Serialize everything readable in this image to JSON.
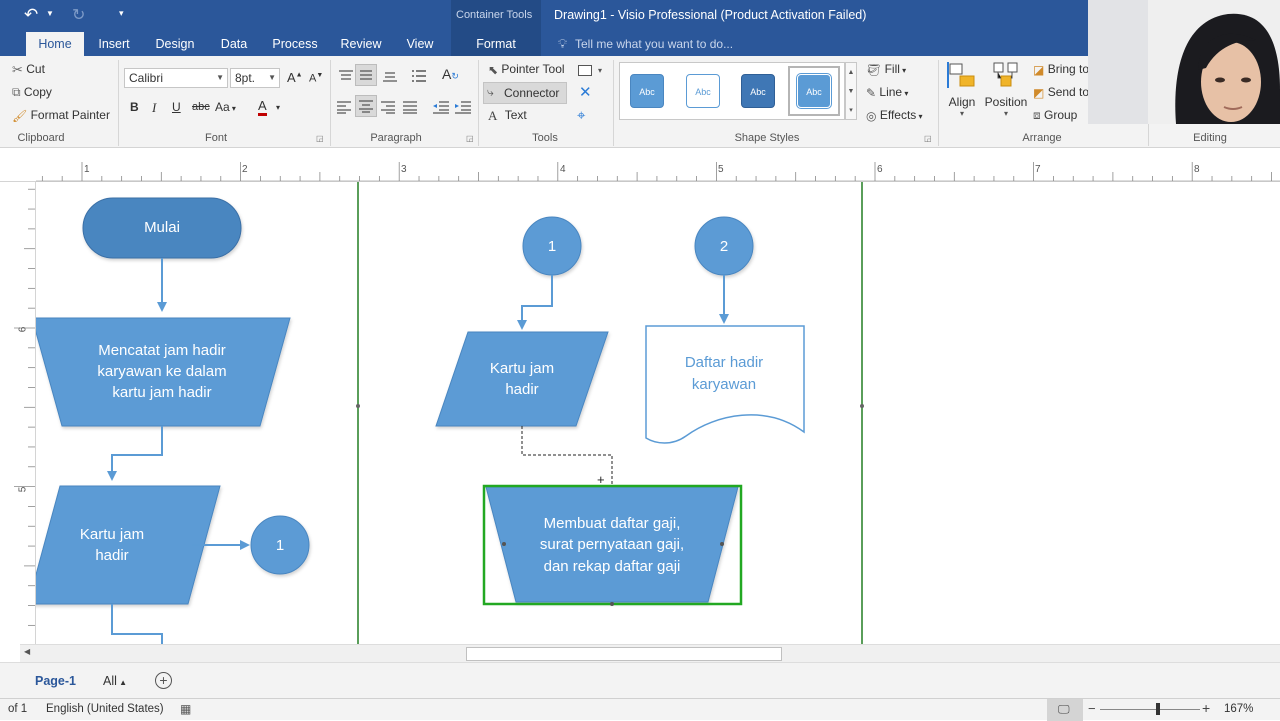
{
  "titlebar": {
    "context_tools": "Container Tools",
    "title": "Drawing1 - Visio Professional (Product Activation Failed)"
  },
  "tabs": {
    "home": "Home",
    "insert": "Insert",
    "design": "Design",
    "data": "Data",
    "process": "Process",
    "review": "Review",
    "view": "View",
    "format": "Format",
    "tell_me": "Tell me what you want to do..."
  },
  "ribbon": {
    "clipboard": {
      "cut": "Cut",
      "copy": "Copy",
      "format_painter": "Format Painter",
      "label": "Clipboard"
    },
    "font": {
      "family": "Calibri",
      "size": "8pt.",
      "label": "Font"
    },
    "paragraph": {
      "label": "Paragraph"
    },
    "tools": {
      "pointer": "Pointer Tool",
      "connector": "Connector",
      "text": "Text",
      "label": "Tools"
    },
    "shape_styles": {
      "abc": "Abc",
      "fill": "Fill",
      "line": "Line",
      "effects": "Effects",
      "label": "Shape Styles"
    },
    "arrange": {
      "align": "Align",
      "position": "Position",
      "bring": "Bring to",
      "send": "Send to",
      "group": "Group",
      "label": "Arrange"
    },
    "editing": {
      "label": "Editing"
    }
  },
  "ruler": {
    "h_ticks": [
      "1",
      "2",
      "3",
      "4",
      "5",
      "6",
      "7",
      "8"
    ],
    "v_ticks": [
      "6",
      "5"
    ]
  },
  "diagram": {
    "mulai": "Mulai",
    "mencatat": [
      "Mencatat jam hadir",
      "karyawan ke dalam",
      "kartu jam hadir"
    ],
    "kartu_left": [
      "Kartu jam",
      "hadir"
    ],
    "connector_1_left": "1",
    "connector_1": "1",
    "connector_2": "2",
    "kartu_mid": [
      "Kartu jam",
      "hadir"
    ],
    "daftar": [
      "Daftar hadir",
      "karyawan"
    ],
    "membuat": [
      "Membuat daftar gaji,",
      "surat pernyataan gaji,",
      "dan rekap daftar gaji"
    ]
  },
  "page_tabs": {
    "page1": "Page-1",
    "all": "All"
  },
  "status": {
    "page": "of 1",
    "language": "English (United States)",
    "zoom": "167%"
  },
  "colors": {
    "accent": "#2b579a",
    "shape": "#5b9bd5",
    "selection": "#22a822",
    "container": "#5a9e5a"
  }
}
